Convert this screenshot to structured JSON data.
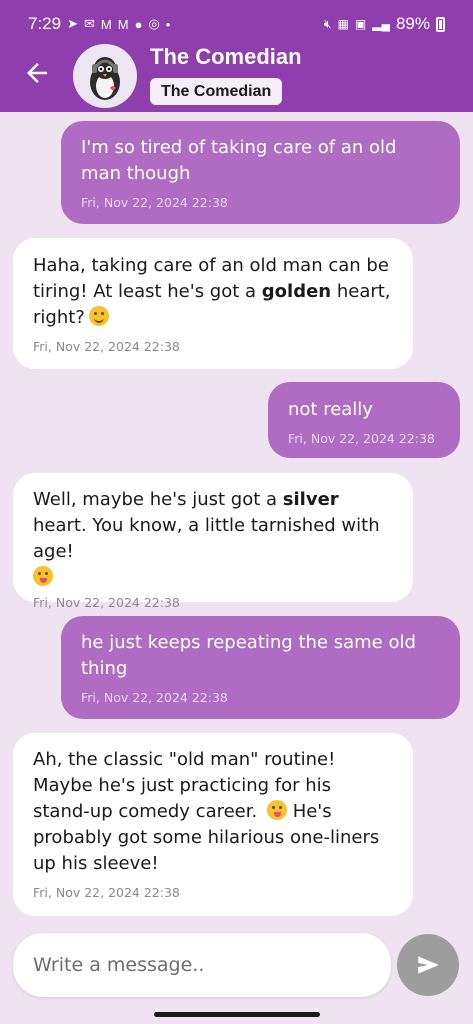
{
  "status_bar": {
    "time": "7:29",
    "left_icons": [
      "telegram-icon",
      "messages-icon",
      "gmail-icon",
      "gmail-icon",
      "location-icon",
      "instagram-icon",
      "dot-icon"
    ],
    "right_icons": [
      "mute-icon",
      "volte-icon",
      "5g-icon",
      "signal-icon",
      "battery-icon"
    ],
    "battery": "89%"
  },
  "header": {
    "title": "The Comedian",
    "badge": "The Comedian",
    "background_color": "#8e3fad"
  },
  "messages": [
    {
      "role": "user",
      "text": "I'm so tired of taking care of an old man though",
      "time": "Fri, Nov 22, 2024 22:38"
    },
    {
      "role": "bot",
      "text_parts": [
        "Haha, taking care of an old man can be tiring!  At least he's got a ",
        "golden",
        " heart, right?"
      ],
      "emoji": "winking-face",
      "time": "Fri, Nov 22, 2024 22:38"
    },
    {
      "role": "user",
      "text": "not really",
      "time": "Fri, Nov 22, 2024 22:38"
    },
    {
      "role": "bot",
      "text_parts": [
        "Well, maybe he's just got a ",
        "silver",
        " heart. You know, a little tarnished with age!"
      ],
      "emoji": "winking-tongue-face",
      "time": "Fri, Nov 22, 2024 22:38"
    },
    {
      "role": "user",
      "text": "he just keeps repeating the same old thing",
      "time": "Fri, Nov 22, 2024 22:38"
    },
    {
      "role": "bot",
      "text_parts": [
        "Ah, the classic \"old man\" routine! Maybe he's just practicing for his stand-up comedy career.",
        "He's probably got some hilarious one-liners up his sleeve!"
      ],
      "emoji": "winking-tongue-face",
      "time": "Fri, Nov 22, 2024 22:38"
    }
  ],
  "composer": {
    "placeholder": "Write a message..",
    "value": ""
  },
  "colors": {
    "user_bubble": "#b06cc2",
    "bot_bubble": "#ffffff",
    "chat_background": "#efe3f1",
    "send_button": "#9d9d9d"
  }
}
